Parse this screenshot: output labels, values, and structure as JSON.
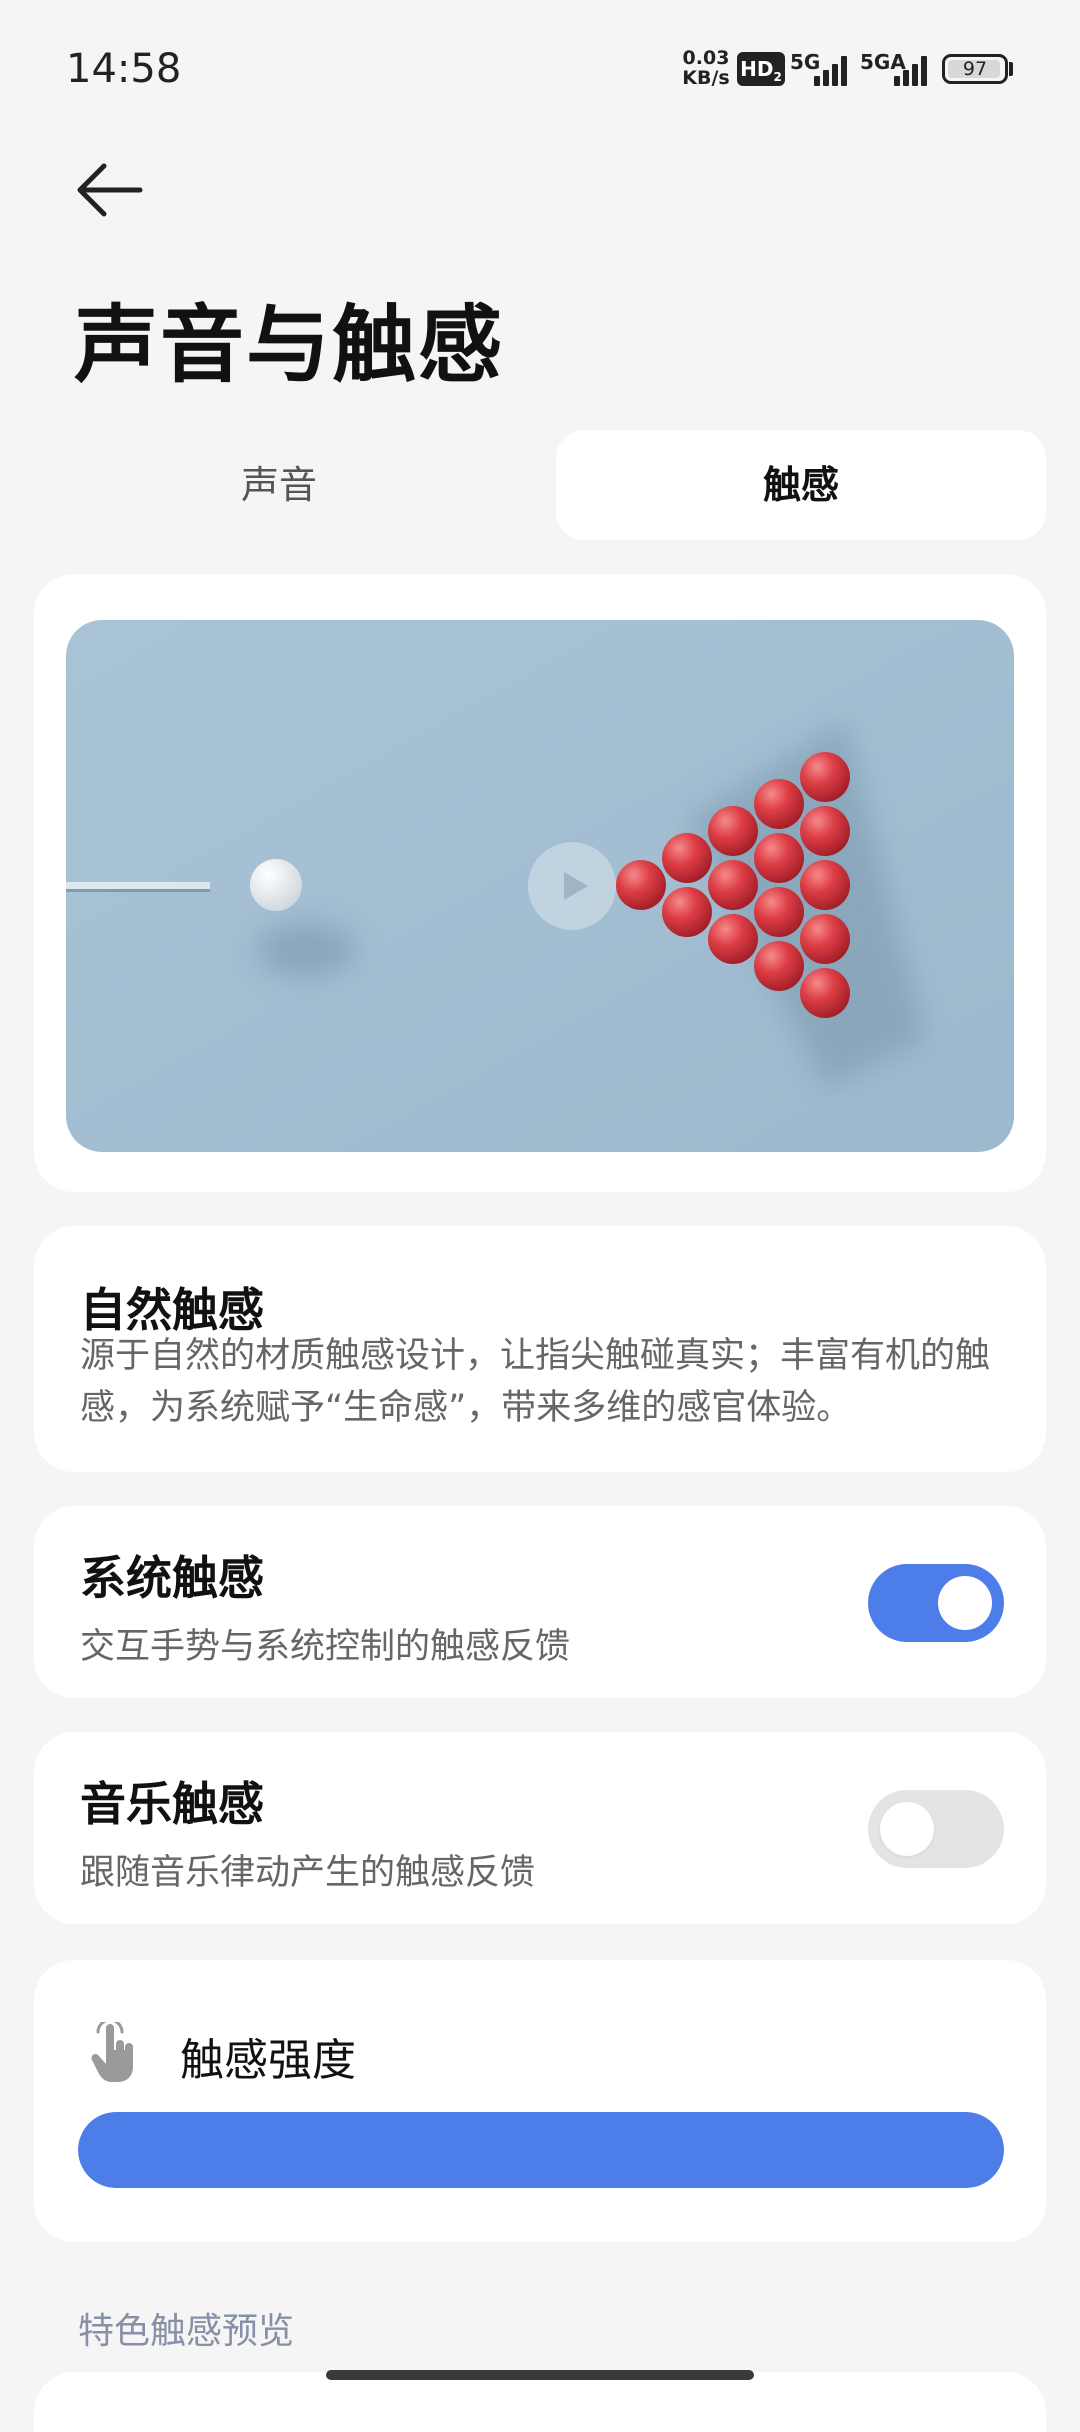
{
  "status_bar": {
    "time": "14:58",
    "net_speed_value": "0.03",
    "net_speed_unit": "KB/s",
    "hd_badge": "HD",
    "hd_sub": "2",
    "signal1_label": "5G",
    "signal2_label": "5GA",
    "battery_level": 97,
    "battery_text": "97"
  },
  "header": {
    "back_icon": "arrow-left-icon",
    "title": "声音与触感"
  },
  "tabs": [
    {
      "label": "声音",
      "active": false
    },
    {
      "label": "触感",
      "active": true
    }
  ],
  "video": {
    "play_icon": "play-icon"
  },
  "natural_haptics": {
    "title": "自然触感",
    "description": "源于自然的材质触感设计，让指尖触碰真实；丰富有机的触感，为系统赋予“生命感”，带来多维的感官体验。"
  },
  "settings": [
    {
      "title": "系统触感",
      "subtitle": "交互手势与系统控制的触感反馈",
      "enabled": true
    },
    {
      "title": "音乐触感",
      "subtitle": "跟随音乐律动产生的触感反馈",
      "enabled": false
    }
  ],
  "intensity": {
    "icon": "touch-hand-icon",
    "title": "触感强度",
    "level_percent": 100
  },
  "section": {
    "label": "特色触感预览"
  },
  "colors": {
    "accent": "#4d7de9",
    "background": "#f5f5f5",
    "card": "#ffffff"
  }
}
